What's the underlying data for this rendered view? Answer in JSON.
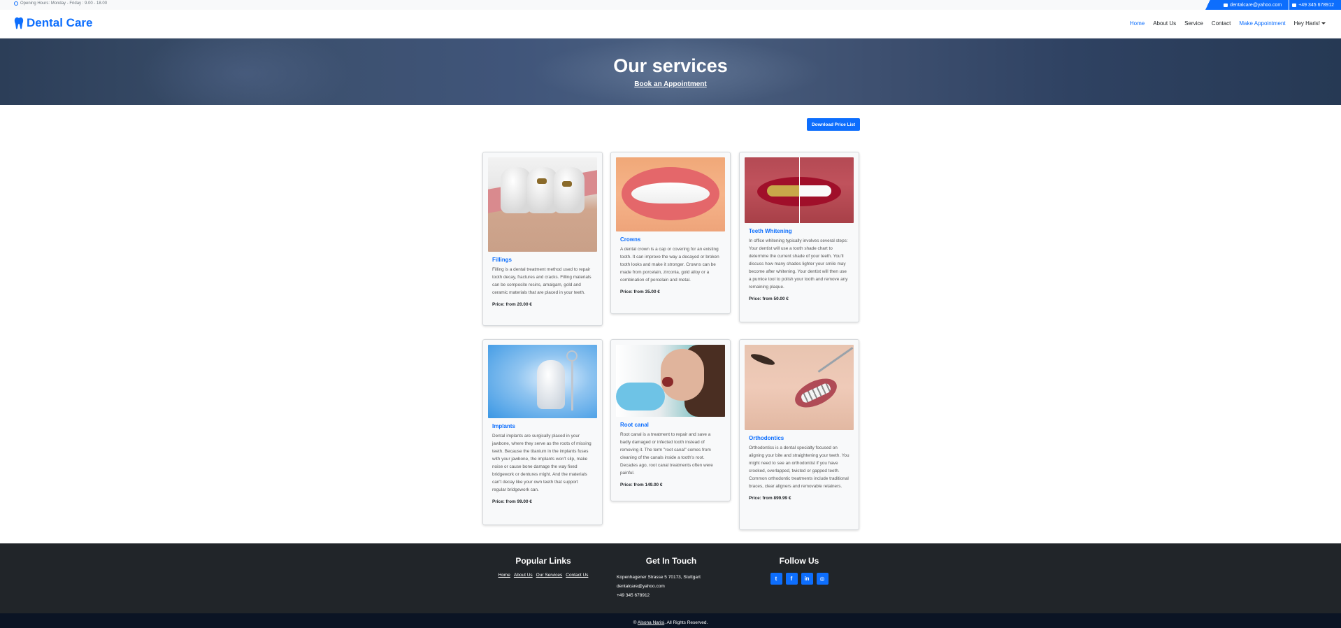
{
  "topbar": {
    "hours": "Opening Hours: Monday - Friday : 9.00 - 18.00",
    "email": "dentalcare@yahoo.com",
    "phone": "+49 345 678912"
  },
  "navbar": {
    "brand": "Dental Care",
    "links": [
      "Home",
      "About Us",
      "Service",
      "Contact",
      "Make Appointment",
      "Hey Haris!"
    ]
  },
  "hero": {
    "title": "Our services",
    "subtitle_link": "Book an Appointment"
  },
  "download_button": "Download Price List",
  "services": [
    {
      "title": "Fillings",
      "desc": "Filling is a dental treatment method used to repair tooth decay, fractures and cracks. Filling materials can be composite resins, amalgam, gold and ceramic materials that are placed in your teeth.",
      "price": "Price: from 20.00 €"
    },
    {
      "title": "Crowns",
      "desc": "A dental crown is a cap or covering for an existing tooth. It can improve the way a decayed or broken tooth looks and make it stronger. Crowns can be made from porcelain, zirconia, gold alloy or a combination of porcelain and metal.",
      "price": "Price: from 35.00 €"
    },
    {
      "title": "Teeth Whitening",
      "desc": "In office whitening typically involves several steps: Your dentist will use a tooth shade chart to determine the current shade of your teeth. You'll discuss how many shades lighter your smile may become after whitening. Your dentist will then use a pumice tool to polish your tooth and remove any remaining plaque.",
      "price": "Price: from 50.00 €"
    },
    {
      "title": "Implants",
      "desc": "Dental implants are surgically placed in your jawbone, where they serve as the roots of missing teeth. Because the titanium in the implants fuses with your jawbone, the implants won't slip, make noise or cause bone damage the way fixed bridgework or dentures might. And the materials can't decay like your own teeth that support regular bridgework can.",
      "price": "Price: from 99.00 €"
    },
    {
      "title": "Root canal",
      "desc": "Root canal is a treatment to repair and save a badly damaged or infected tooth instead of removing it. The term \"root canal\" comes from cleaning of the canals inside a tooth's root. Decades ago, root canal treatments often were painful.",
      "price": "Price: from 149.00 €"
    },
    {
      "title": "Orthodontics",
      "desc": "Orthodontics is a dental specialty focused on aligning your bite and straightening your teeth. You might need to see an orthodontist if you have crooked, overlapped, twisted or gapped teeth. Common orthodontic treatments include traditional braces, clear aligners and removable retainers.",
      "price": "Price: from 899.99 €"
    }
  ],
  "footer": {
    "popular_title": "Popular Links",
    "popular_links": [
      "Home",
      "About Us",
      "Our Services",
      "Contact Us"
    ],
    "touch_title": "Get In Touch",
    "address": "Kopenhagener Strasse 5 70173, Stuttgart",
    "email": "dentalcare@yahoo.com",
    "phone": "+49 345 678912",
    "follow_title": "Follow Us",
    "social_icons": [
      "twitter-icon",
      "facebook-icon",
      "linkedin-icon",
      "instagram-icon"
    ]
  },
  "copyright": {
    "prefix": "©",
    "owner": "Alsona Narisi",
    "suffix": ". All Rights Reserved."
  },
  "colors": {
    "primary": "#0d6efd",
    "footer_bg": "#212529",
    "bottom_bg": "#0b1424"
  }
}
